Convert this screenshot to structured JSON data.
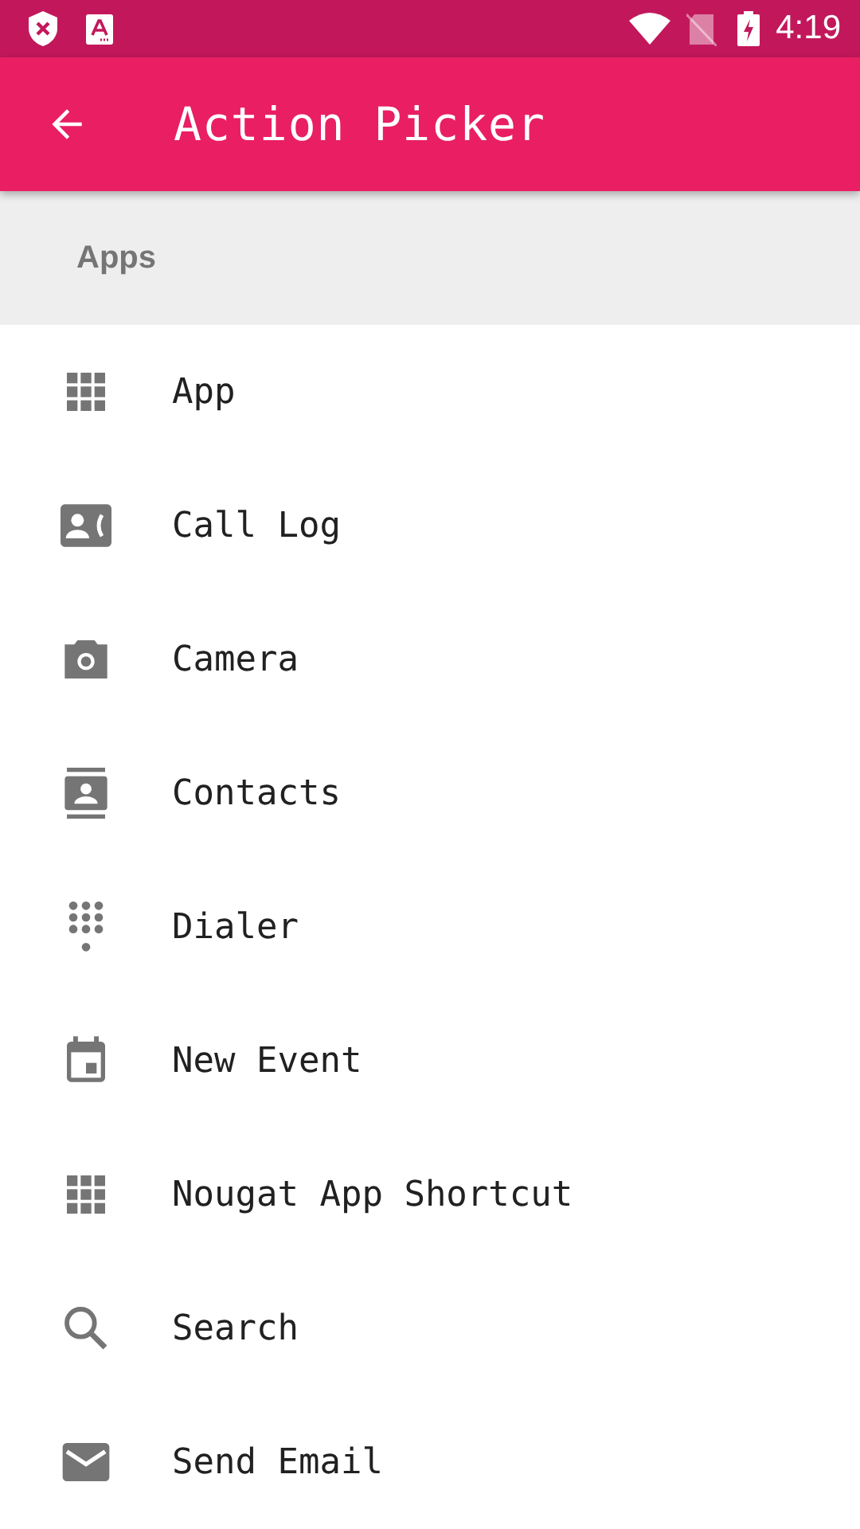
{
  "status_bar": {
    "time": "4:19"
  },
  "app_bar": {
    "title": "Action Picker"
  },
  "section": {
    "title": "Apps"
  },
  "items": [
    {
      "label": "App",
      "kind": "grid"
    },
    {
      "label": "Call Log",
      "kind": "calllog"
    },
    {
      "label": "Camera",
      "kind": "camera"
    },
    {
      "label": "Contacts",
      "kind": "contacts"
    },
    {
      "label": "Dialer",
      "kind": "dialpad"
    },
    {
      "label": "New Event",
      "kind": "event"
    },
    {
      "label": "Nougat App Shortcut",
      "kind": "grid"
    },
    {
      "label": "Search",
      "kind": "search"
    },
    {
      "label": "Send Email",
      "kind": "email"
    }
  ]
}
